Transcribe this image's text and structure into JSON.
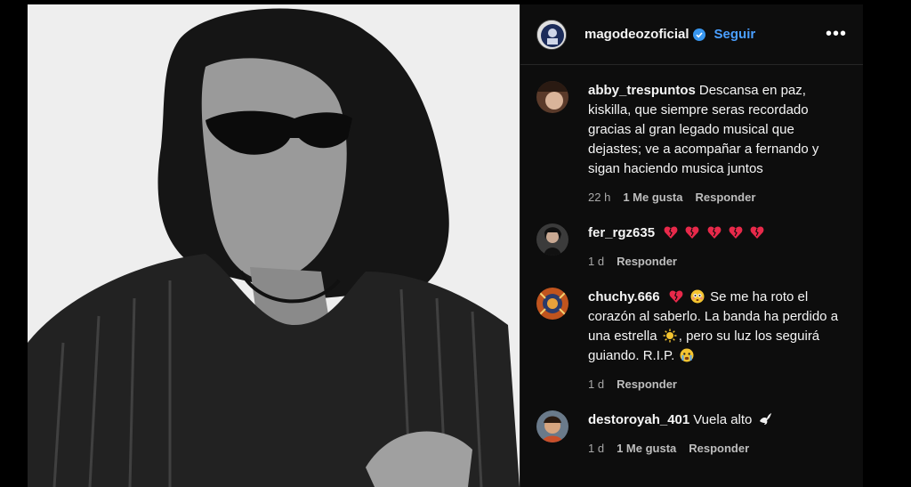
{
  "header": {
    "username": "magodeozoficial",
    "follow_label": "Seguir",
    "more_label": "•••",
    "verified": true
  },
  "comments": [
    {
      "username": "abby_trespuntos",
      "text": "Descansa en paz, kiskilla, que siempre seras recordado gracias al gran legado musical que dejastes; ve a acompañar a fernando y sigan haciendo musica juntos",
      "time": "22 h",
      "likes": "1 Me gusta",
      "reply": "Responder"
    },
    {
      "username": "fer_rgz635",
      "text": "",
      "emojis": [
        "broken-heart",
        "broken-heart",
        "broken-heart",
        "broken-heart",
        "broken-heart"
      ],
      "time": "1 d",
      "likes": "",
      "reply": "Responder"
    },
    {
      "username": "chuchy.666",
      "text_part1": "Se me ha roto el corazón al saberlo. La banda ha perdido a una estrella",
      "text_part2": ", pero su luz los seguirá guiando. R.I.P.",
      "time": "1 d",
      "likes": "",
      "reply": "Responder"
    },
    {
      "username": "destoroyah_401",
      "text": "Vuela alto",
      "time": "1 d",
      "likes": "1 Me gusta",
      "reply": "Responder"
    }
  ],
  "colors": {
    "background": "#000000",
    "panel": "#0d0d0d",
    "follow": "#4a9fff",
    "verified": "#3897f0",
    "heart": "#e8294a"
  }
}
